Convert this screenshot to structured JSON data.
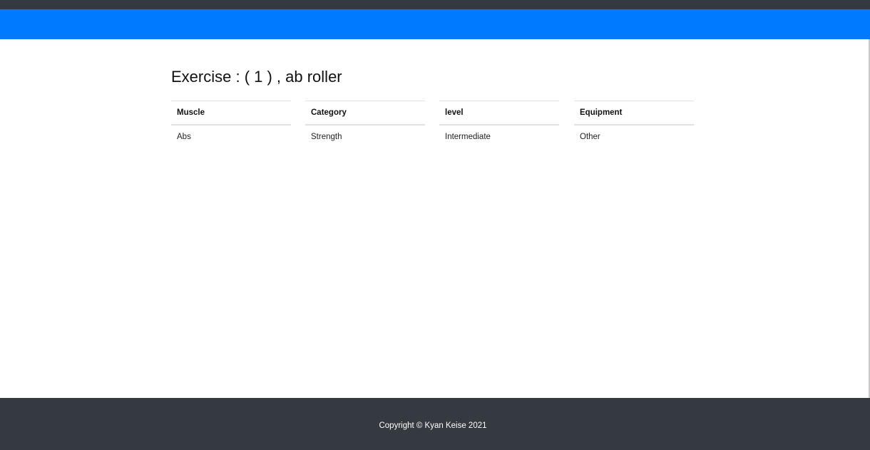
{
  "main": {
    "title": "Exercise : ( 1 ) , ab roller",
    "columns": [
      {
        "header": "Muscle",
        "value": "Abs"
      },
      {
        "header": "Category",
        "value": "Strength"
      },
      {
        "header": "level",
        "value": "Intermediate"
      },
      {
        "header": "Equipment",
        "value": "Other"
      }
    ]
  },
  "footer": {
    "copyright": "Copyright © Kyan Keise 2021"
  },
  "colors": {
    "navbar": "#007bff",
    "topbar": "#343a40",
    "footer": "#343a40"
  }
}
